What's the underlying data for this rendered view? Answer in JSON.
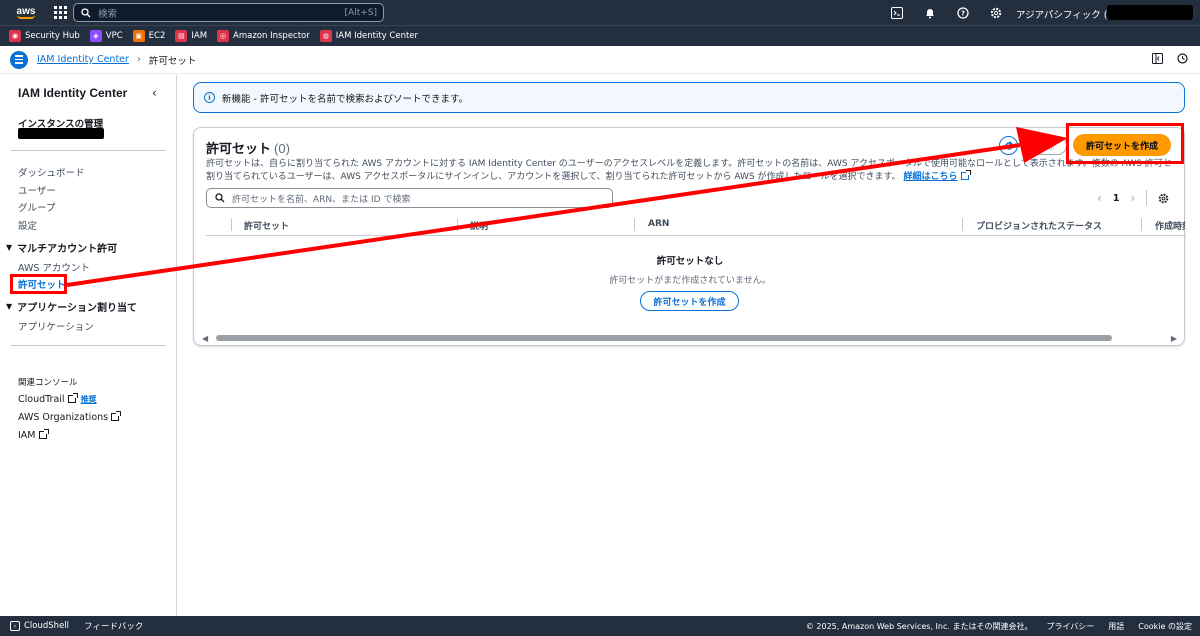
{
  "topnav": {
    "logo": "aws",
    "search_placeholder": "検索",
    "search_shortcut": "[Alt+S]",
    "region": "アジアパシフィック (東京) ▾",
    "icons": [
      "cloudshell-icon",
      "bell-icon",
      "help-icon",
      "settings-icon"
    ]
  },
  "favorites": [
    {
      "label": "Security Hub",
      "color": "#dd344c"
    },
    {
      "label": "VPC",
      "color": "#8c4fff"
    },
    {
      "label": "EC2",
      "color": "#ed7100"
    },
    {
      "label": "IAM",
      "color": "#dd344c"
    },
    {
      "label": "Amazon Inspector",
      "color": "#dd344c"
    },
    {
      "label": "IAM Identity Center",
      "color": "#dd344c"
    }
  ],
  "breadcrumb": {
    "root": "IAM Identity Center",
    "current": "許可セット"
  },
  "sidebar": {
    "title": "IAM Identity Center",
    "instance_label": "インスタンスの管理",
    "items_top": [
      "ダッシュボード",
      "ユーザー",
      "グループ",
      "設定"
    ],
    "section_multi": "マルチアカウント許可",
    "multi_items": [
      "AWS アカウント",
      "許可セット"
    ],
    "section_app": "アプリケーション割り当て",
    "app_items": [
      "アプリケーション"
    ],
    "related_title": "関連コンソール",
    "related": [
      {
        "label": "CloudTrail",
        "badge": "推奨"
      },
      {
        "label": "AWS Organizations",
        "badge": ""
      },
      {
        "label": "IAM",
        "badge": ""
      }
    ]
  },
  "flash": {
    "text": "新機能 - 許可セットを名前で検索およびソートできます。"
  },
  "panel": {
    "title": "許可セット",
    "count": "(0)",
    "desc_line1": "許可セットは、自らに割り当てられた AWS アカウントに対する IAM Identity Center のユーザーのアクセスレベルを定義します。許可セットの名前は、AWS アクセスポータルで使用可能なロールとして表示されます。複数の AWS 許可セットに",
    "desc_line2": "割り当てられているユーザーは、AWS アクセスポータルにサインインし、アカウントを選択して、割り当てられた許可セットから AWS が作成したロールを選択できます。",
    "learn_more": "詳細はこちら",
    "delete_label": "削除",
    "create_label": "許可セットを作成",
    "filter_placeholder": "許可セットを名前、ARN、または ID で検索",
    "page": "1",
    "columns": [
      "許可セット",
      "説明",
      "ARN",
      "プロビジョンされたステータス",
      "作成時刻"
    ],
    "empty_title": "許可セットなし",
    "empty_sub": "許可セットがまだ作成されていません。",
    "empty_button": "許可セットを作成"
  },
  "footer": {
    "cloudshell": "CloudShell",
    "feedback": "フィードバック",
    "copyright": "© 2025, Amazon Web Services, Inc. またはその関連会社。",
    "privacy": "プライバシー",
    "terms": "用語",
    "cookies": "Cookie の設定"
  },
  "colors": {
    "nav_bg": "#232f3e",
    "link": "#0972d3",
    "primary_btn": "#ff9900",
    "annotation": "#ff0000"
  }
}
